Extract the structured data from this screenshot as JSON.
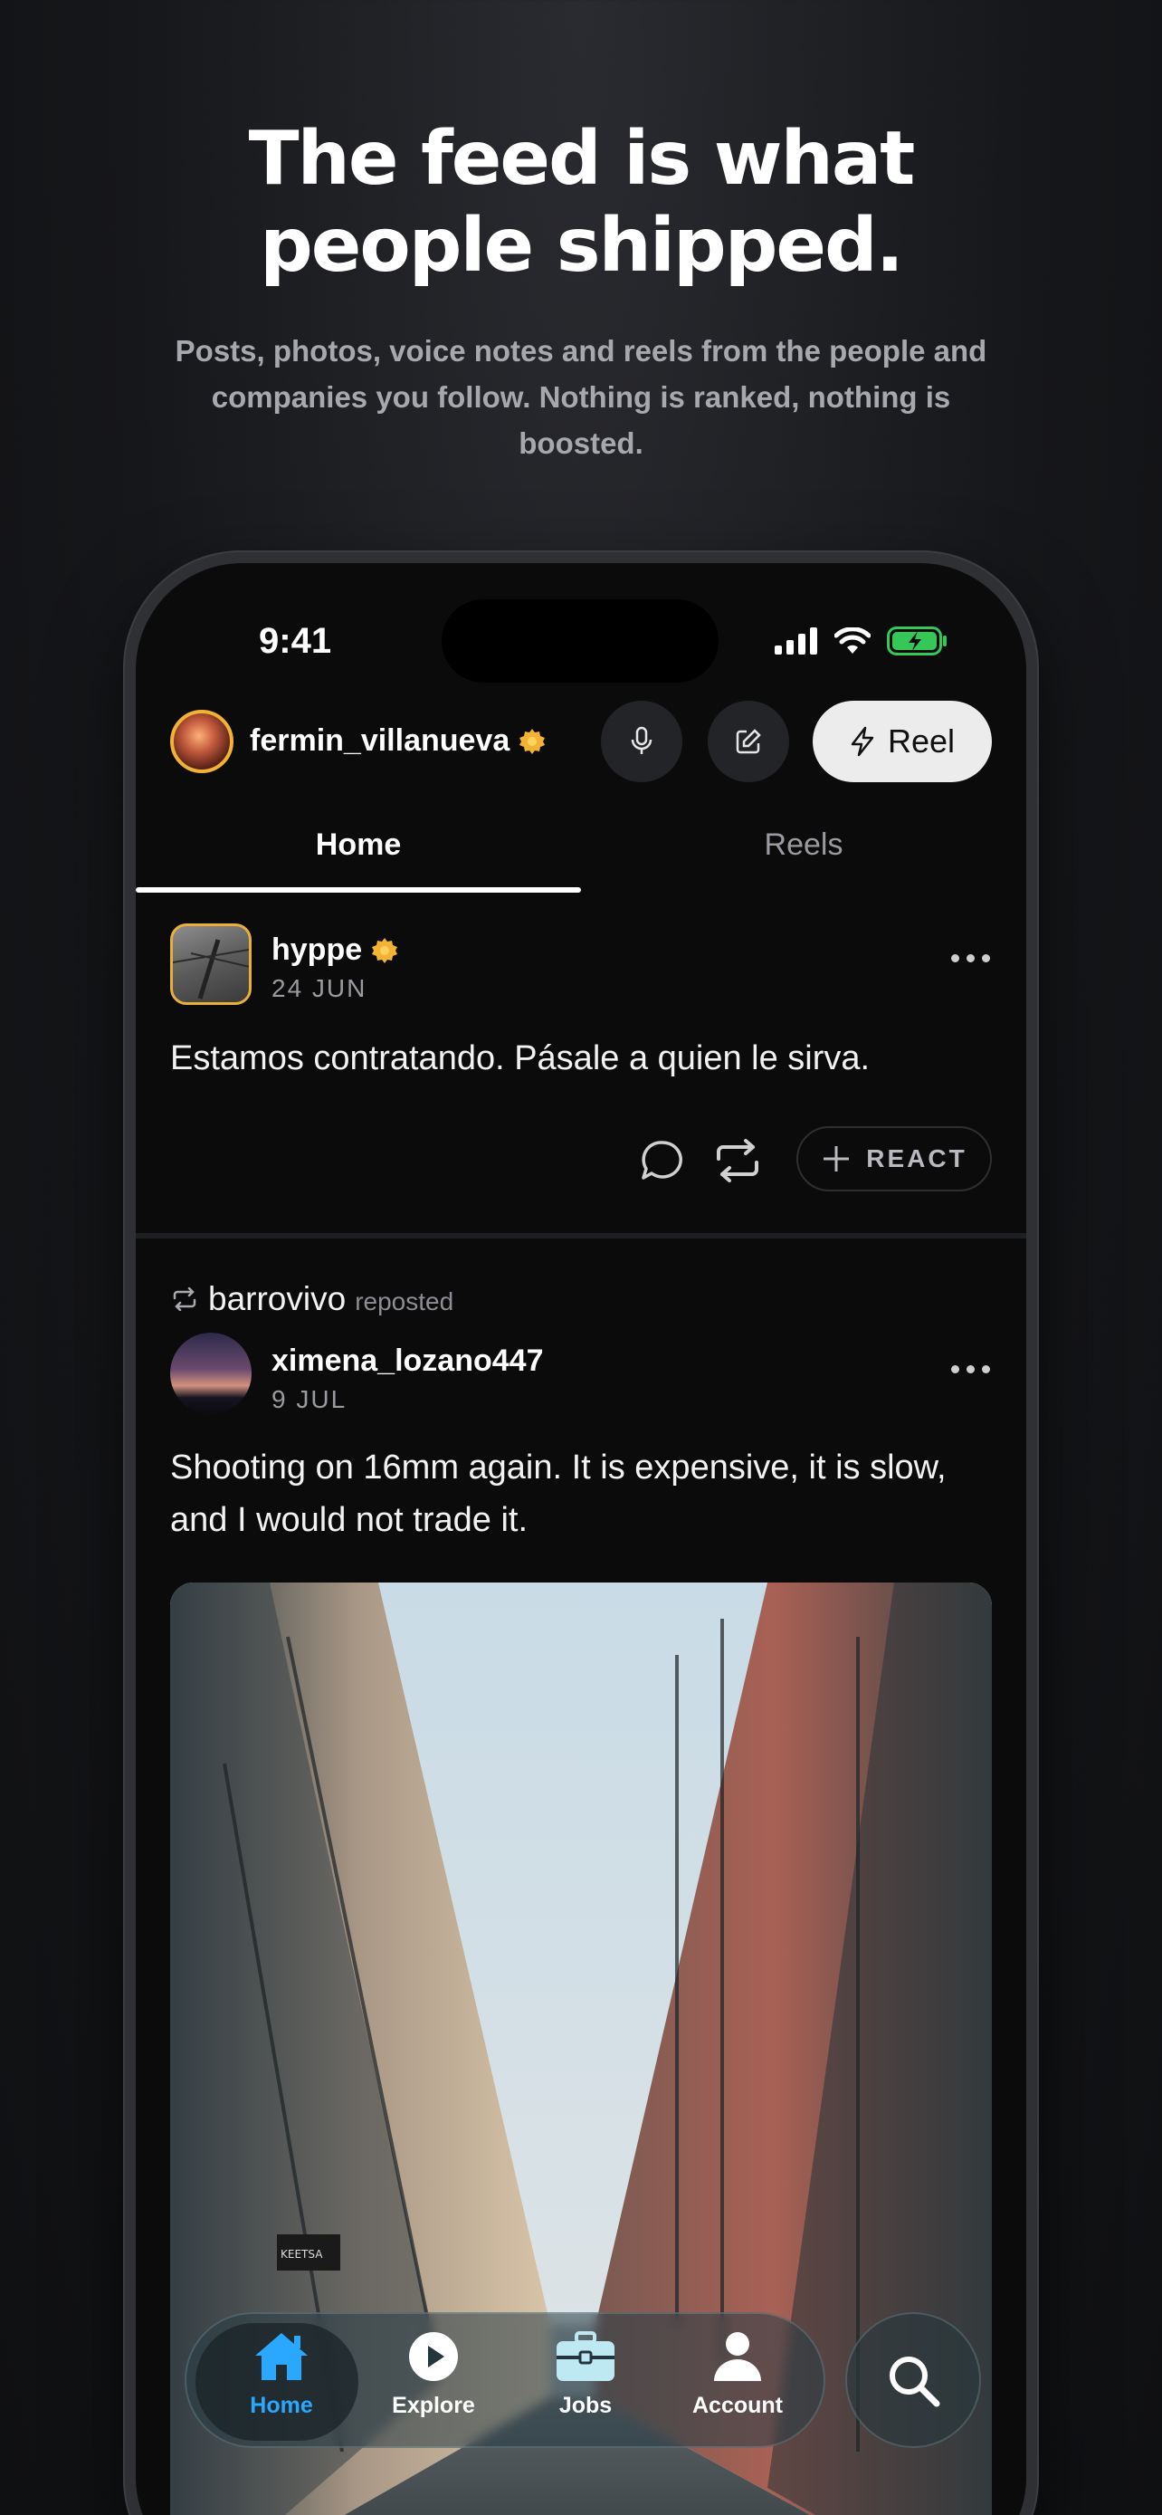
{
  "marketing": {
    "headline_line1": "The feed is what",
    "headline_line2": "people shipped.",
    "subhead": "Posts, photos, voice notes and reels from the people and companies you follow. Nothing is ranked, nothing is boosted."
  },
  "status_bar": {
    "time": "9:41"
  },
  "header": {
    "username": "fermin_villanueva",
    "reel_label": "Reel",
    "icons": [
      "mic-icon",
      "compose-icon",
      "bolt-icon"
    ]
  },
  "tabs": [
    {
      "label": "Home",
      "active": true
    },
    {
      "label": "Reels",
      "active": false
    }
  ],
  "posts": [
    {
      "author": "hyppe",
      "date": "24 JUN",
      "verified": true,
      "text": "Estamos contratando. Pásale a quien le sirva.",
      "react_label": "REACT"
    },
    {
      "reposted_by": "barrovivo",
      "reposted_label": "reposted",
      "author": "ximena_lozano447",
      "date": "9 JUL",
      "text": "Shooting on 16mm again. It is expensive, it is slow, and I would not trade it.",
      "image_sign": "KEETSA"
    }
  ],
  "tabbar": {
    "items": [
      {
        "label": "Home",
        "icon": "home-icon",
        "active": true
      },
      {
        "label": "Explore",
        "icon": "play-icon",
        "active": false
      },
      {
        "label": "Jobs",
        "icon": "briefcase-icon",
        "active": false
      },
      {
        "label": "Account",
        "icon": "person-icon",
        "active": false
      }
    ]
  },
  "colors": {
    "accent_blue": "#2aa8ff",
    "verified_gold": "#f2b233",
    "battery_green": "#36c759"
  }
}
